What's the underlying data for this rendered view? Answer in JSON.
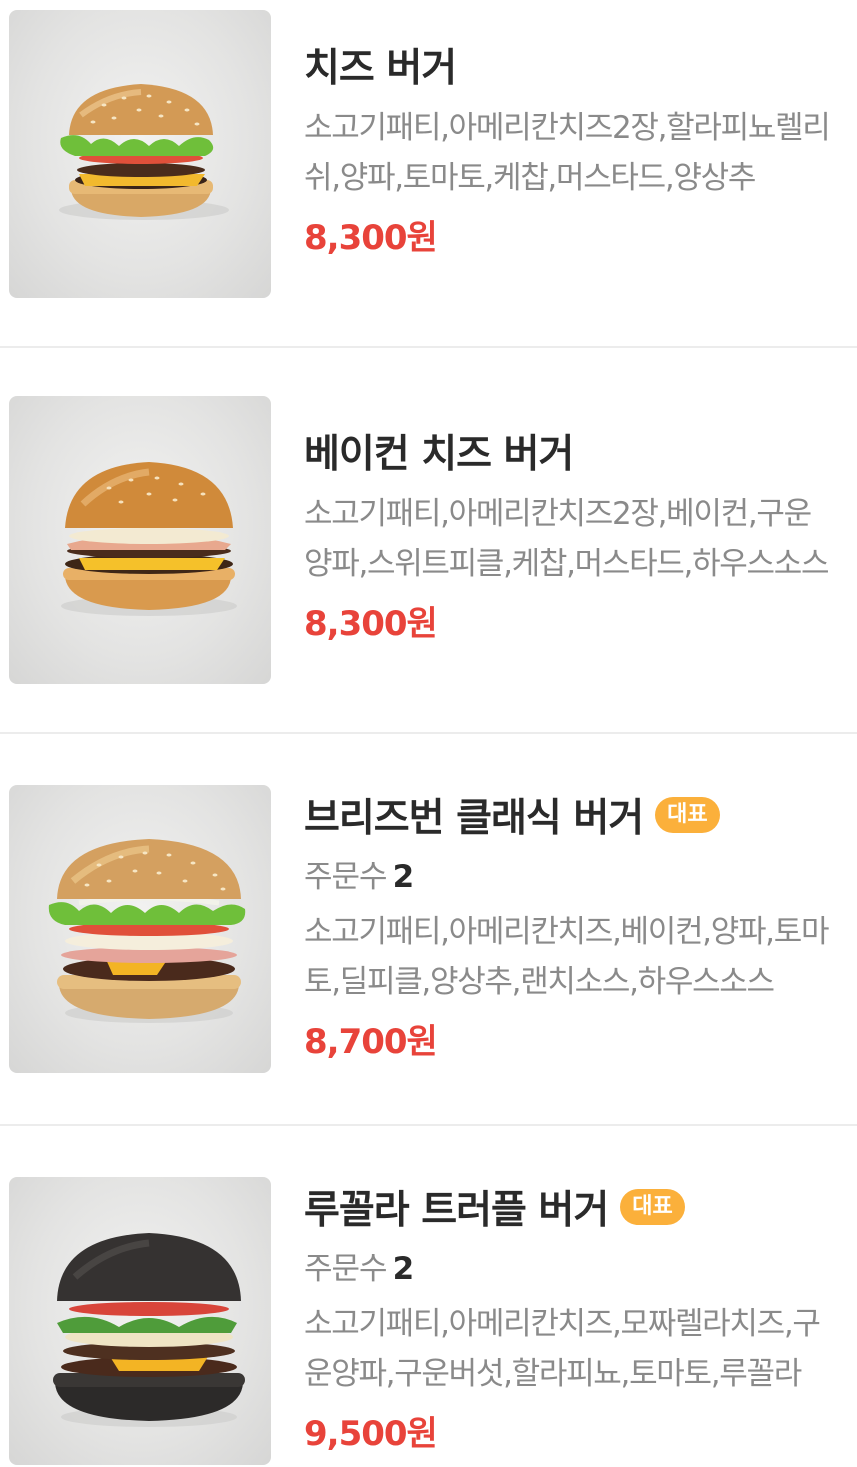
{
  "colors": {
    "price": "#e8433a",
    "badge": "#fbb03b",
    "title": "#2a2a2a",
    "muted": "#8a8a8a"
  },
  "items": [
    {
      "name": "치즈 버거",
      "badge": "",
      "order_label": "",
      "order_count": "",
      "description": "소고기패티,아메리칸치즈2장,할라피뇨렐리쉬,양파,토마토,케찹,머스타드,양상추",
      "price": "8,300원",
      "image_icon": "cheese-burger-image"
    },
    {
      "name": "베이컨 치즈 버거",
      "badge": "",
      "order_label": "",
      "order_count": "",
      "description": "소고기패티,아메리칸치즈2장,베이컨,구운양파,스위트피클,케찹,머스타드,하우스소스",
      "price": "8,300원",
      "image_icon": "bacon-cheese-burger-image"
    },
    {
      "name": "브리즈번 클래식 버거",
      "badge": "대표",
      "order_label": "주문수",
      "order_count": "2",
      "description": "소고기패티,아메리칸치즈,베이컨,양파,토마토,딜피클,양상추,랜치소스,하우스소스",
      "price": "8,700원",
      "image_icon": "brisbane-classic-burger-image"
    },
    {
      "name": "루꼴라 트러플 버거",
      "badge": "대표",
      "order_label": "주문수",
      "order_count": "2",
      "description": "소고기패티,아메리칸치즈,모짜렐라치즈,구운양파,구운버섯,할라피뇨,토마토,루꼴라",
      "price": "9,500원",
      "image_icon": "arugula-truffle-burger-image"
    }
  ]
}
